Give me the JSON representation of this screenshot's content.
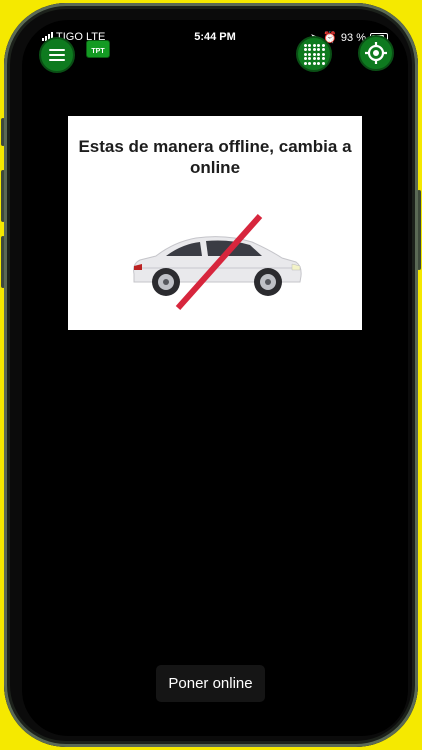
{
  "status_bar": {
    "carrier": "TIGO  LTE",
    "time": "5:44 PM",
    "battery_percent": "93 %"
  },
  "header": {
    "badge_label": "TPT",
    "icons": [
      "menu-icon",
      "dot-grid-icon",
      "crosshair-locate-icon"
    ]
  },
  "offline_notice": {
    "message": "Estas de manera offline, cambia a online",
    "illustration": "car-crossed-out-icon"
  },
  "actions": {
    "go_online_label": "Poner online"
  },
  "colors": {
    "accent_green": "#0e7a1f",
    "frame_yellow": "#f5e900",
    "cross_red": "#d7263d"
  }
}
